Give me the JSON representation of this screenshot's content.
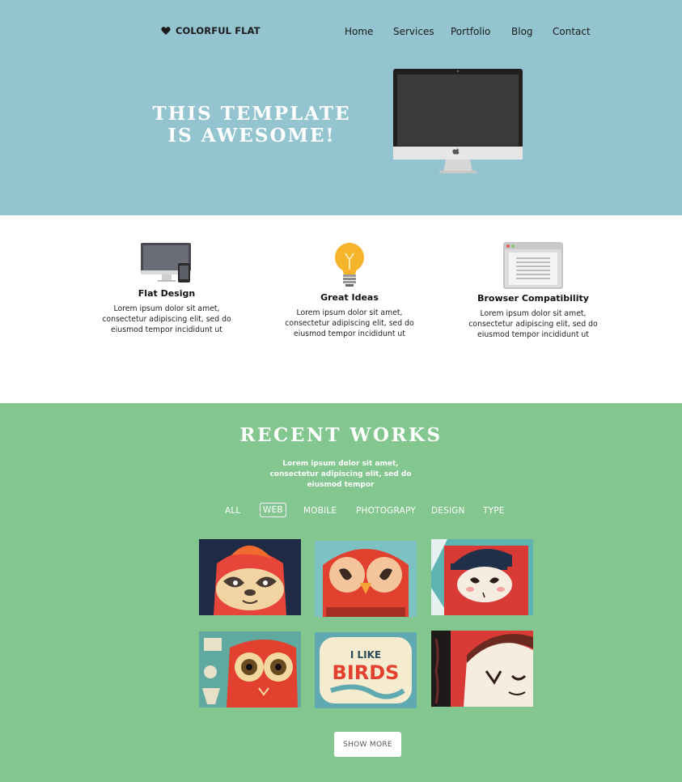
{
  "header": {
    "logo_text": "COLORFUL FLAT",
    "logo_icon": "heart-icon",
    "nav": [
      "Home",
      "Services",
      "Portfolio",
      "Blog",
      "Contact"
    ]
  },
  "hero": {
    "title_line1": "THIS TEMPLATE",
    "title_line2": "IS AWESOME!",
    "image": "imac-monitor"
  },
  "features": [
    {
      "icon": "devices-icon",
      "title": "Flat Design",
      "text": "Lorem ipsum dolor sit amet, consectetur adipiscing elit, sed do eiusmod tempor incididunt ut"
    },
    {
      "icon": "lightbulb-icon",
      "title": "Great Ideas",
      "text": "Lorem ipsum dolor sit amet, consectetur adipiscing elit, sed do eiusmod tempor incididunt ut"
    },
    {
      "icon": "browser-window-icon",
      "title": "Browser Compatibility",
      "text": "Lorem ipsum dolor sit amet, consectetur adipiscing elit, sed do eiusmod tempor incididunt ut"
    }
  ],
  "works": {
    "title": "RECENT WORKS",
    "subtitle": "Lorem ipsum dolor sit amet, consectetur adipiscing elit, sed do eiusmod tempor",
    "filters": [
      "ALL",
      "WEB",
      "MOBILE",
      "PHOTOGRAPY",
      "DESIGN",
      "TYPE"
    ],
    "active_filter": "WEB",
    "thumb_text": "I LIKE BIRDS",
    "show_more": "SHOW MORE"
  },
  "colors": {
    "hero_bg": "#93c4cf",
    "works_bg": "#83c68f",
    "accent_red": "#e2412f"
  }
}
